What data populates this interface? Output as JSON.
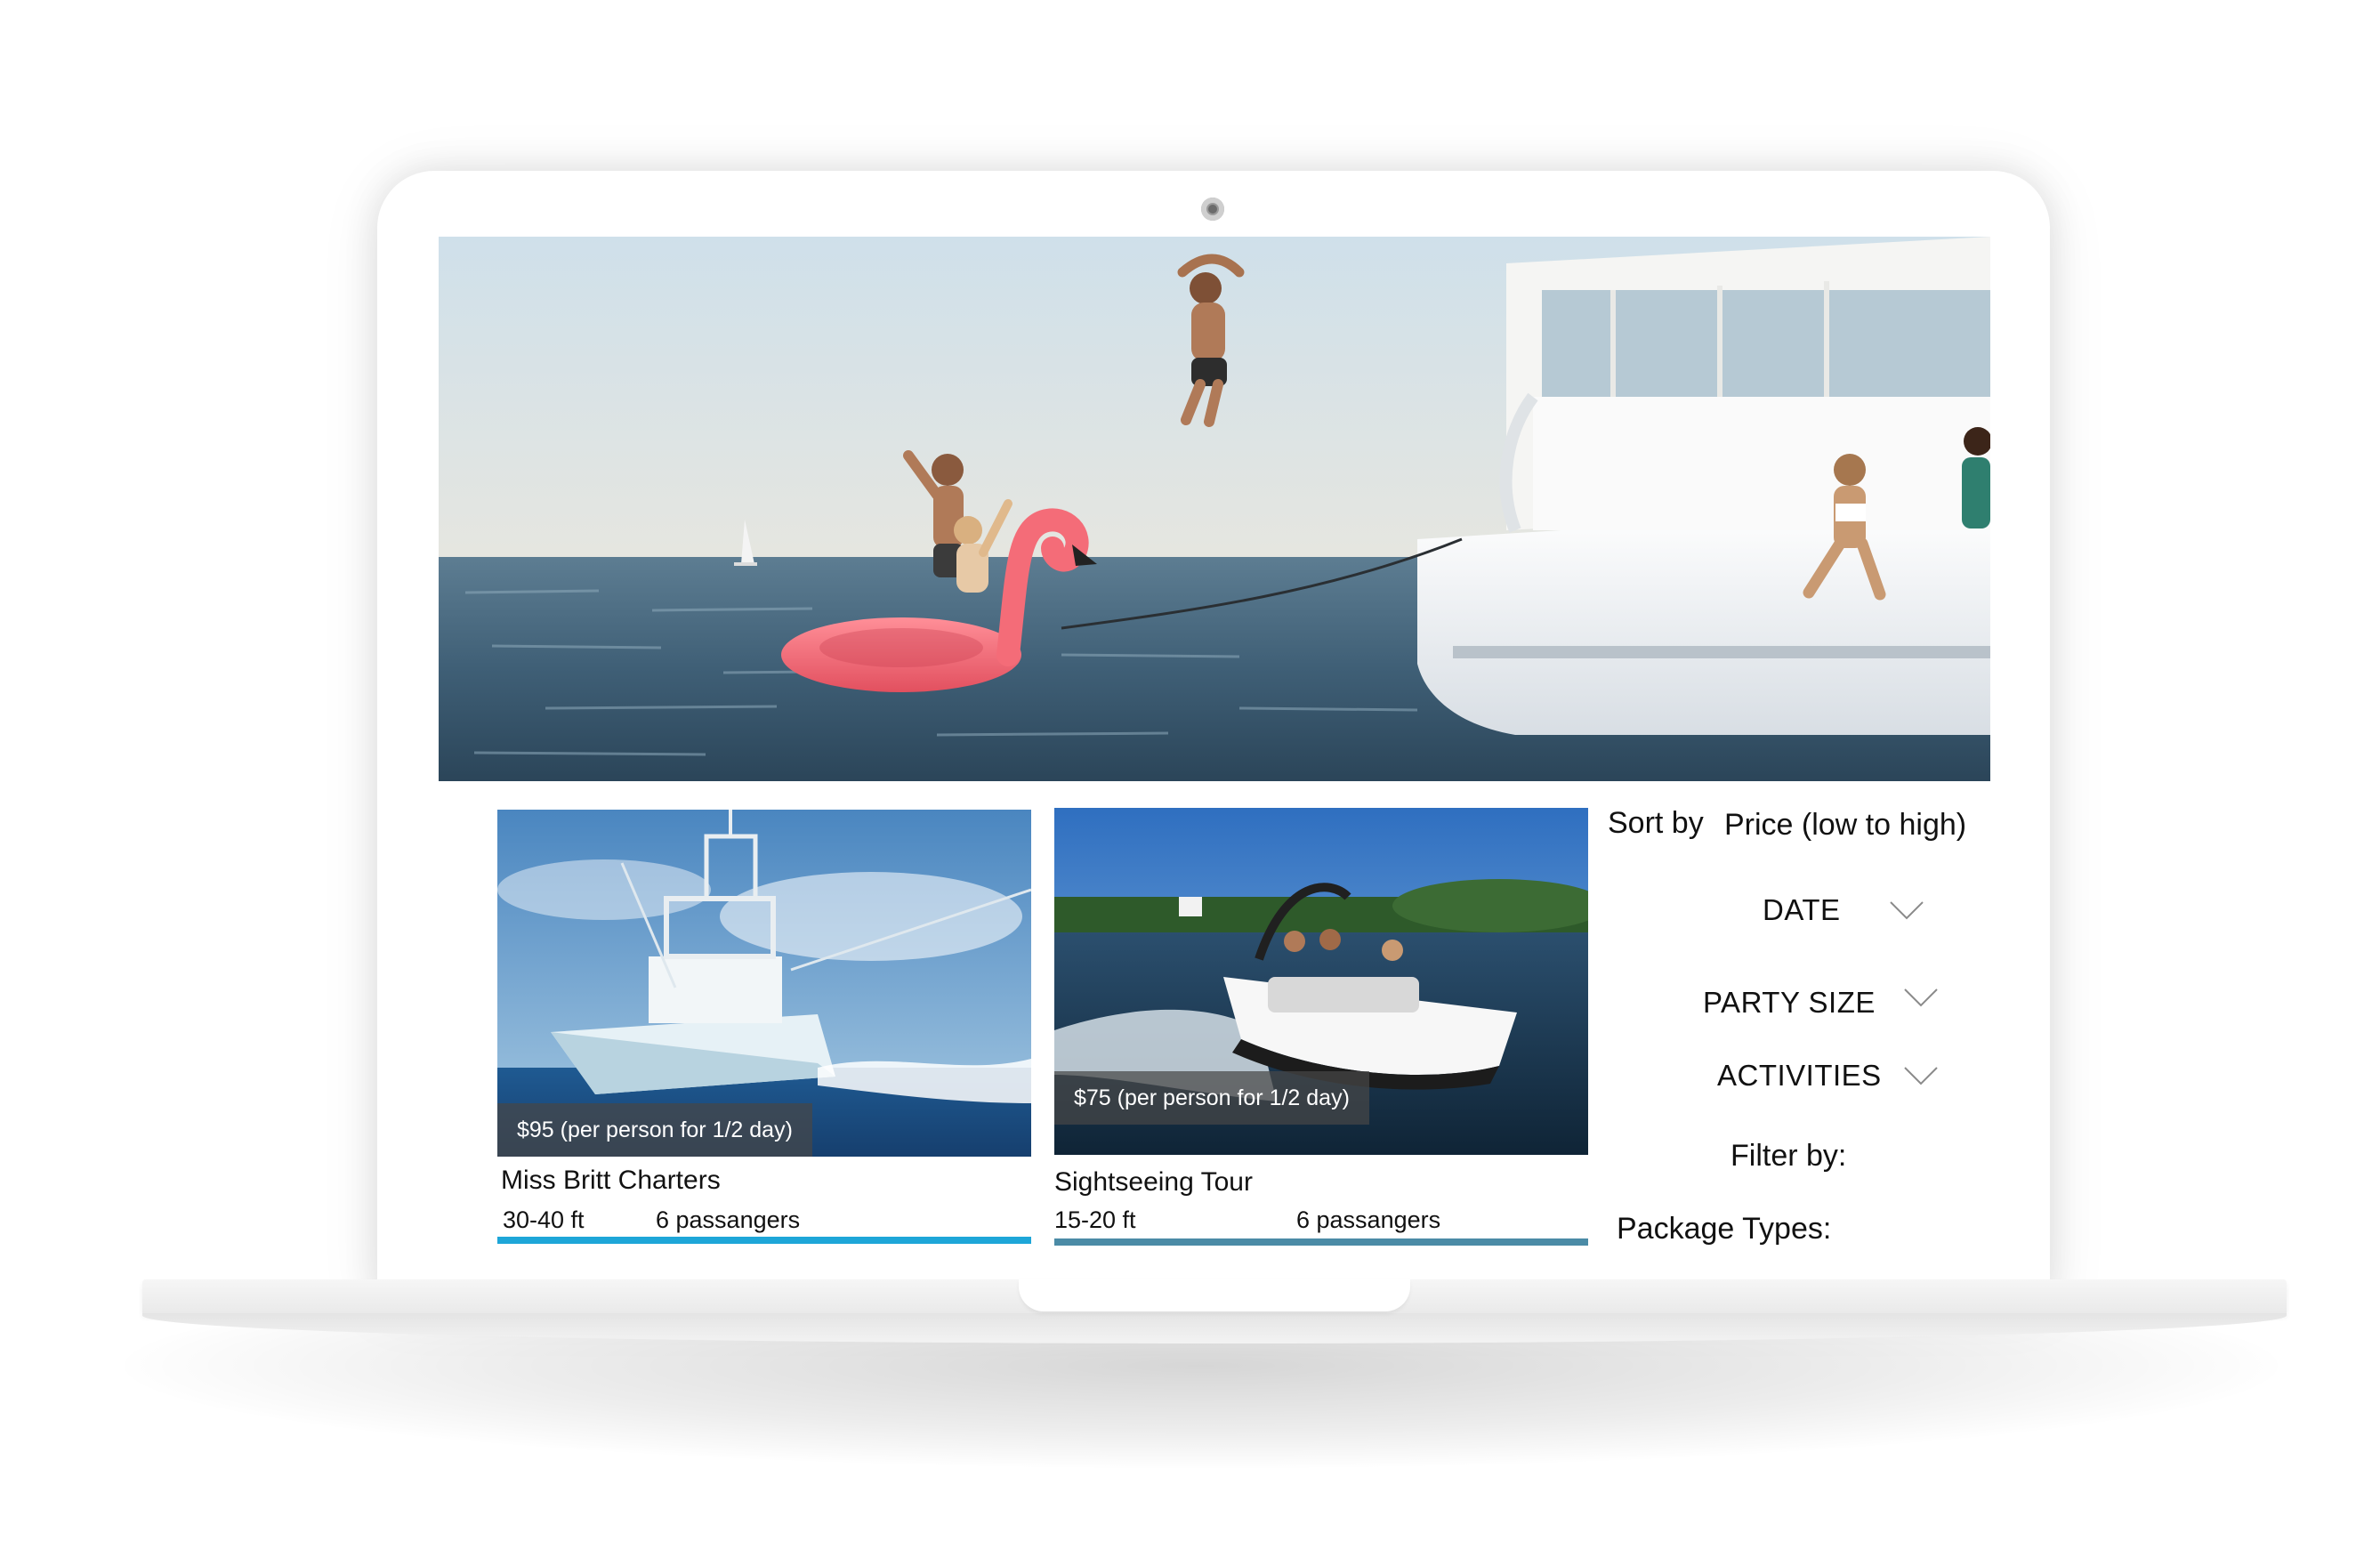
{
  "cards": [
    {
      "price": "$95 (per person for 1/2 day)",
      "title": "Miss Britt Charters",
      "length": "30-40 ft",
      "passengers": "6 passangers"
    },
    {
      "price": "$75 (per person for 1/2 day)",
      "title": "Sightseeing Tour",
      "length": "15-20 ft",
      "passengers": "6 passangers"
    }
  ],
  "sidebar": {
    "sort_label": "Sort by",
    "sort_value": "Price (low to high)",
    "date_label": "DATE",
    "party_size_label": "PARTY SIZE",
    "activities_label": "ACTIVITIES",
    "filter_label": "Filter by:",
    "package_types_label": "Package Types:"
  },
  "colors": {
    "accent_bar": "#1ea6d8",
    "price_tag_bg": "rgba(70,70,70,0.72)"
  },
  "icons": {
    "date_dropdown": "chevron-down-icon",
    "party_size_dropdown": "chevron-down-icon",
    "activities_dropdown": "chevron-down-icon",
    "camera": "webcam-icon"
  }
}
